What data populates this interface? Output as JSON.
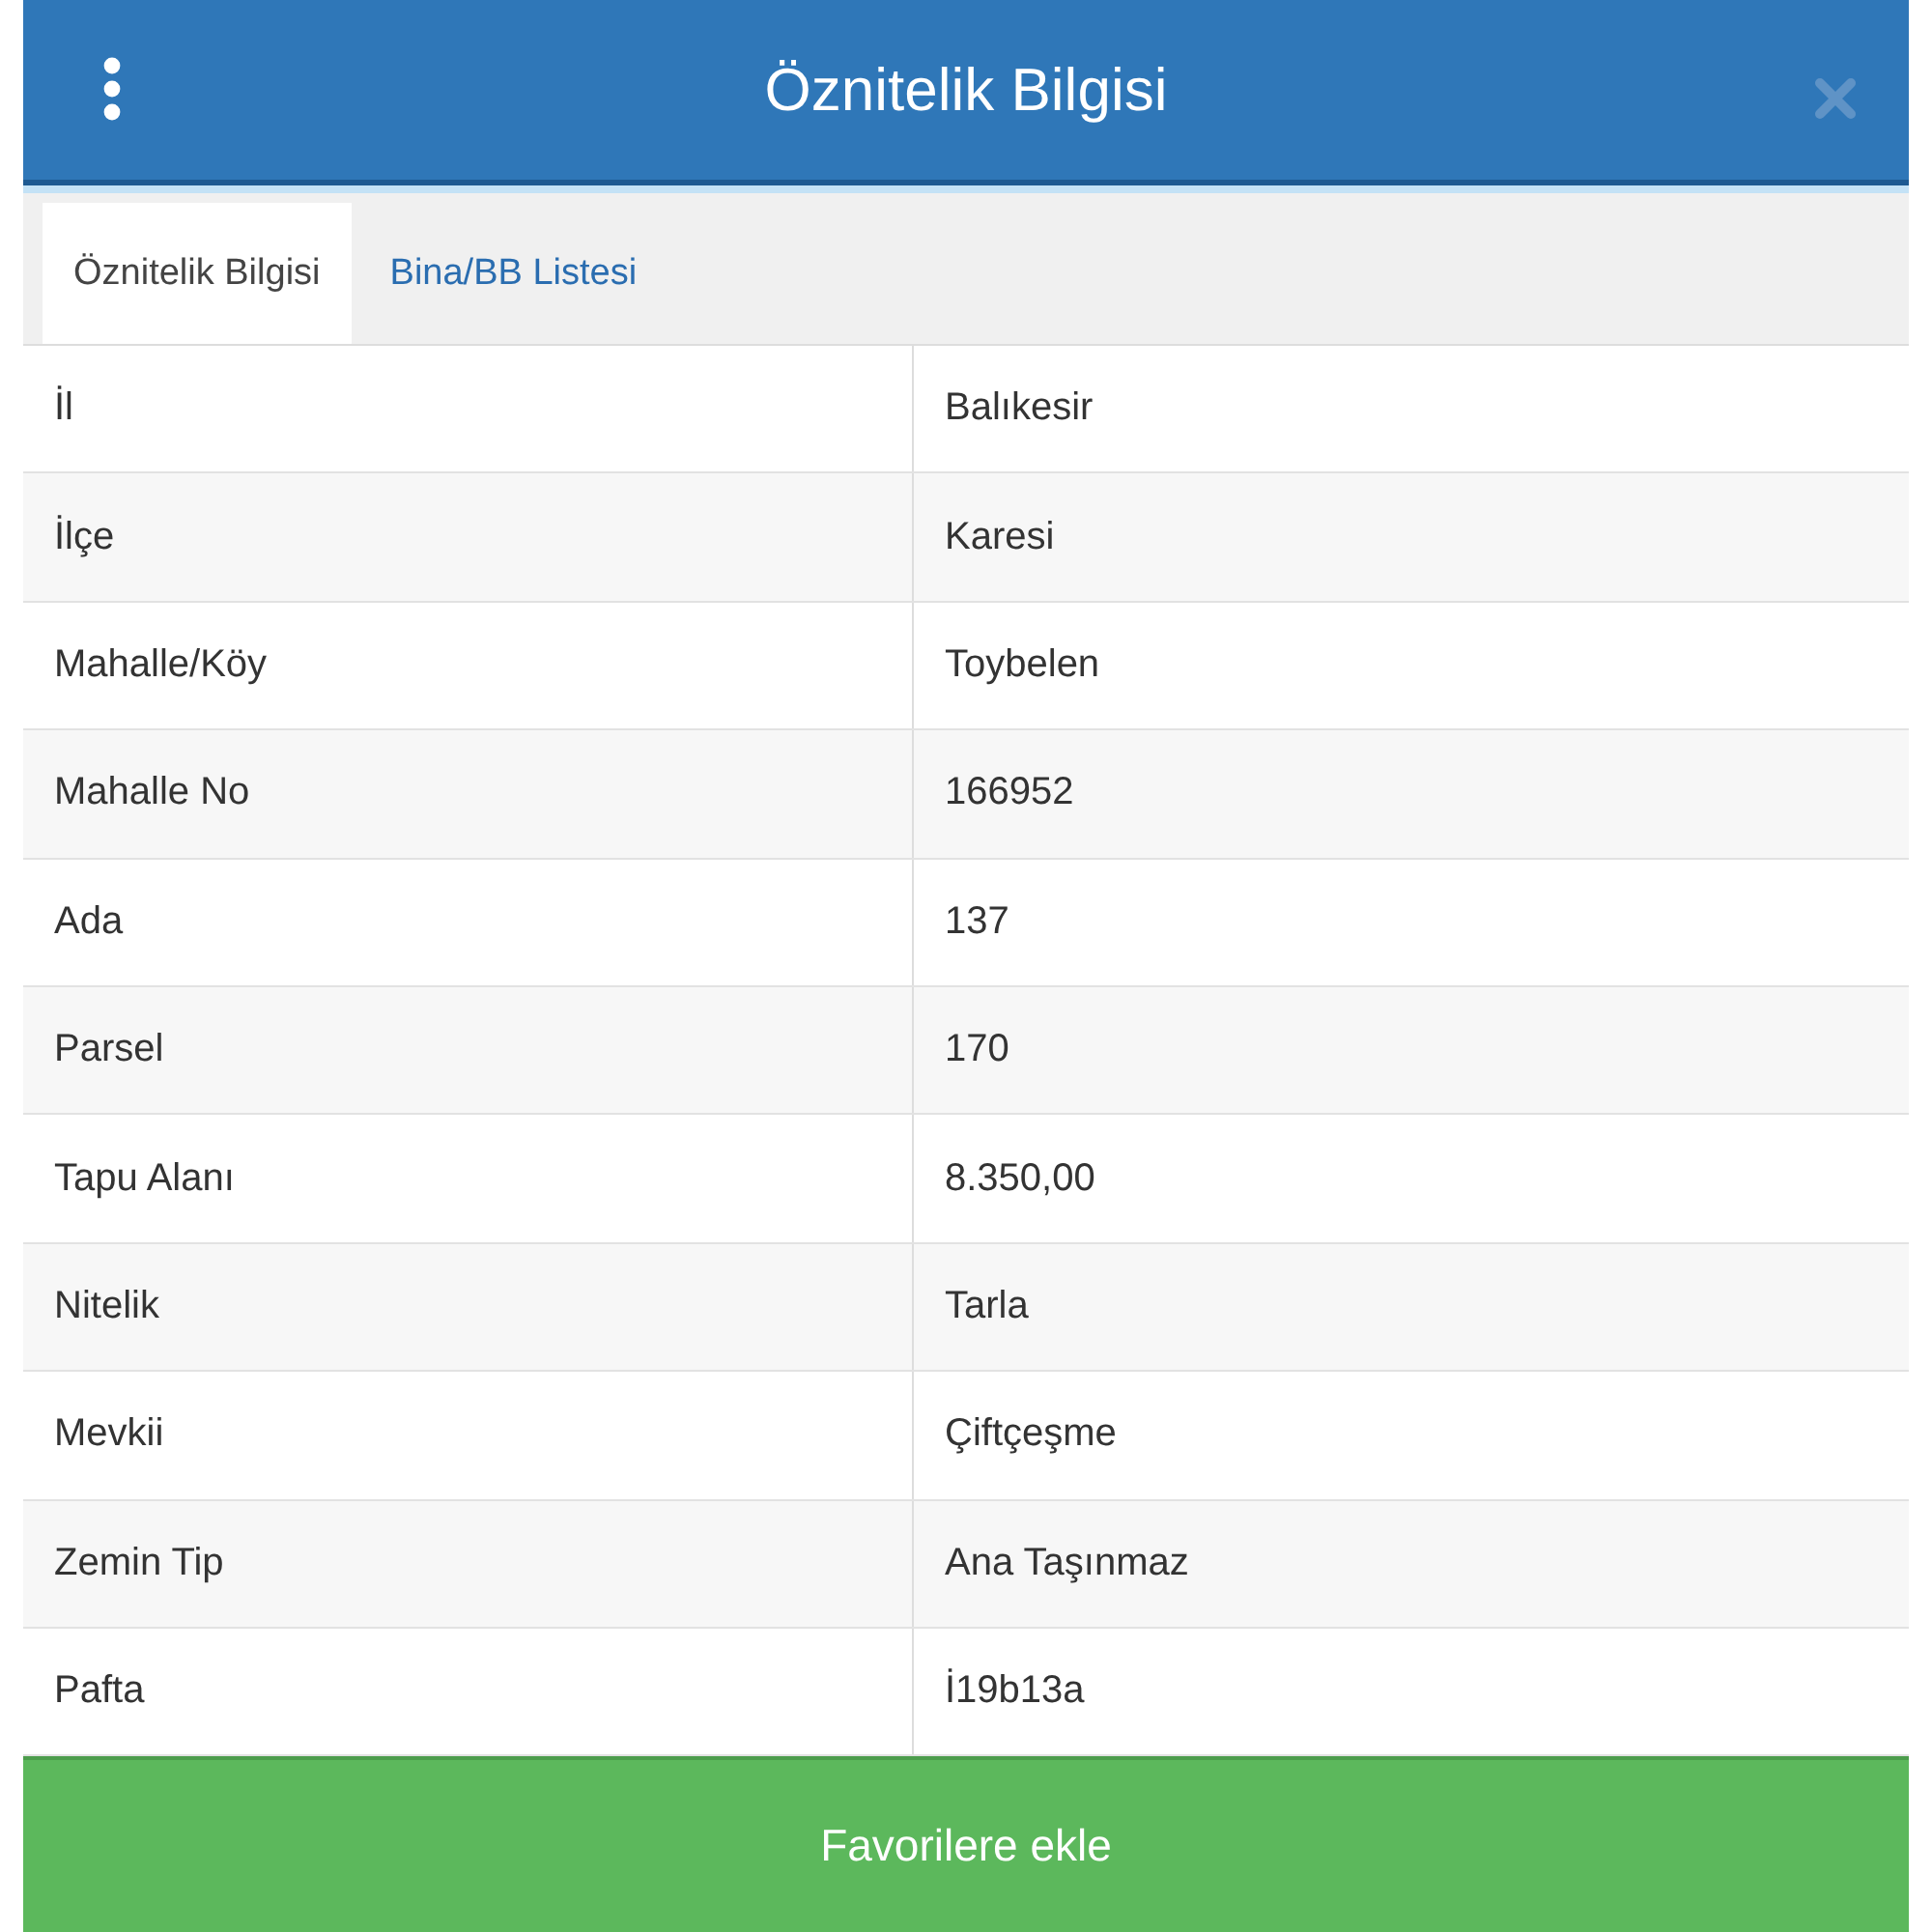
{
  "header": {
    "title": "Öznitelik Bilgisi"
  },
  "tabs": [
    {
      "label": "Öznitelik Bilgisi",
      "selected": true
    },
    {
      "label": "Bina/BB Listesi",
      "selected": false
    }
  ],
  "rows": [
    {
      "label": "İl",
      "value": "Balıkesir"
    },
    {
      "label": "İlçe",
      "value": "Karesi"
    },
    {
      "label": "Mahalle/Köy",
      "value": "Toybelen"
    },
    {
      "label": "Mahalle No",
      "value": "166952"
    },
    {
      "label": "Ada",
      "value": "137"
    },
    {
      "label": "Parsel",
      "value": "170"
    },
    {
      "label": "Tapu Alanı",
      "value": "8.350,00"
    },
    {
      "label": "Nitelik",
      "value": "Tarla"
    },
    {
      "label": "Mevkii",
      "value": "Çiftçeşme"
    },
    {
      "label": "Zemin Tip",
      "value": "Ana Taşınmaz"
    },
    {
      "label": "Pafta",
      "value": "İ19b13a"
    }
  ],
  "footer": {
    "button": "Favorilere ekle"
  }
}
